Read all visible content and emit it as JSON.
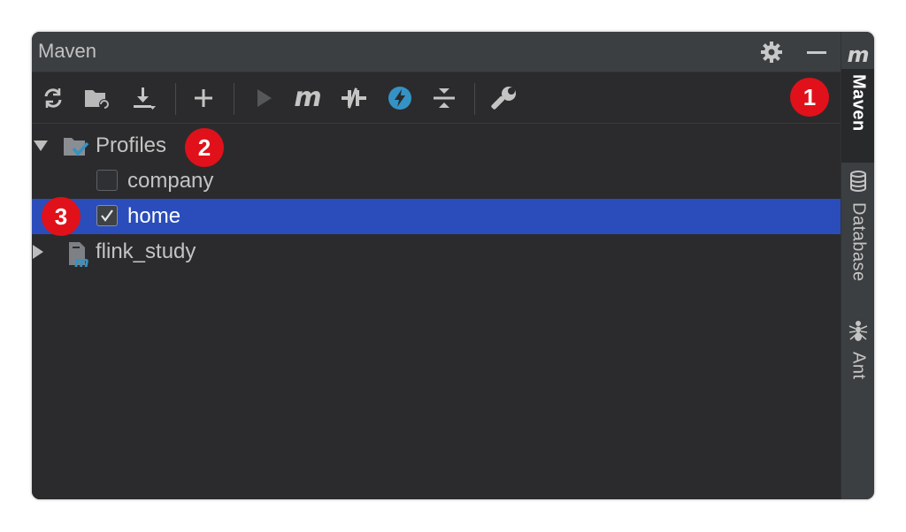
{
  "panel": {
    "title": "Maven",
    "settings_icon": "gear-icon",
    "minimize_icon": "minimize-icon"
  },
  "toolbar": {
    "buttons": [
      {
        "name": "reload-icon"
      },
      {
        "name": "generate-sources-icon"
      },
      {
        "name": "download-icon"
      },
      {
        "name": "add-icon"
      },
      {
        "name": "run-icon"
      },
      {
        "name": "maven-goal-icon"
      },
      {
        "name": "toggle-offline-icon"
      },
      {
        "name": "skip-tests-icon"
      },
      {
        "name": "collapse-all-icon"
      },
      {
        "name": "wrench-icon"
      }
    ]
  },
  "tree": {
    "profiles_label": "Profiles",
    "profiles": [
      {
        "label": "company",
        "checked": false
      },
      {
        "label": "home",
        "checked": true,
        "selected": true
      }
    ],
    "project_label": "flink_study"
  },
  "annotations": [
    "1",
    "2",
    "3"
  ],
  "sidebar": {
    "tabs": [
      {
        "label": "Maven",
        "icon": "maven-m-icon",
        "active": true
      },
      {
        "label": "Database",
        "icon": "database-icon",
        "active": false
      },
      {
        "label": "Ant",
        "icon": "ant-icon",
        "active": false
      }
    ],
    "top_icon": "maven-m-icon"
  },
  "colors": {
    "background": "#2b2b2d",
    "header": "#3c3f41",
    "selection": "#2a4dbb",
    "badge": "#e0111a",
    "accent_blue": "#3592c4"
  }
}
